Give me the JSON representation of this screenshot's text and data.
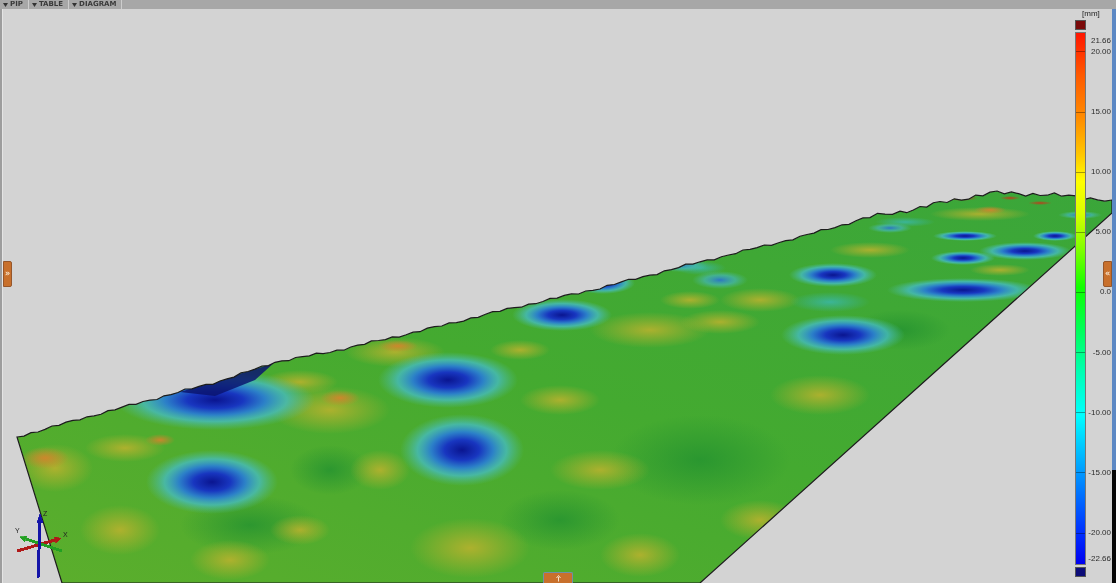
{
  "tabs": [
    {
      "label": "PIP"
    },
    {
      "label": "TABLE"
    },
    {
      "label": "DIAGRAM"
    }
  ],
  "viewport": {
    "panel_toggles": [
      {
        "kind": "left",
        "label": "»"
      },
      {
        "kind": "right",
        "label": "«"
      },
      {
        "kind": "bottom"
      }
    ]
  },
  "color_scale": {
    "unit": "[mm]",
    "ticks": [
      "21.66",
      "20.00",
      "15.00",
      "10.00",
      "5.00",
      "0.0",
      "-5.00",
      "-10.00",
      "-15.00",
      "-20.00",
      "-22.66"
    ]
  },
  "axes": [
    {
      "label": "X",
      "color": "#b01818"
    },
    {
      "label": "Y",
      "color": "#22a022"
    },
    {
      "label": "Z",
      "color": "#1414a8"
    }
  ]
}
